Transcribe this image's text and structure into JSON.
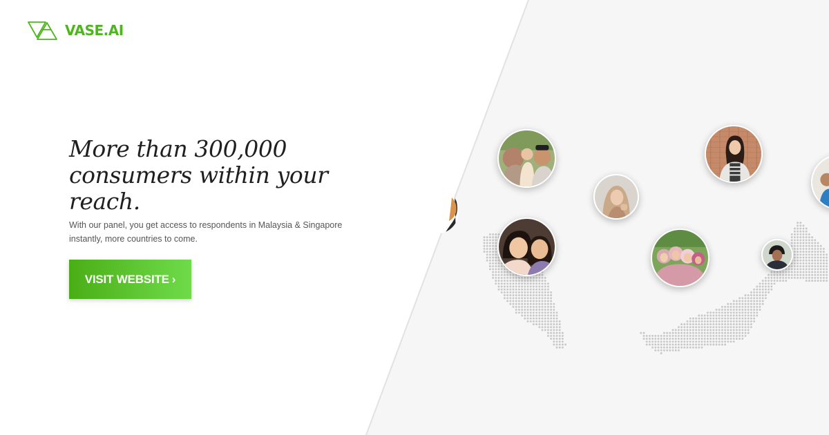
{
  "brand": {
    "name": "VASE.AI",
    "color": "#4fb51f"
  },
  "hero": {
    "headline": "More than 300,000 consumers within your reach.",
    "subtext": "With our panel, you get access to respondents in Malaysia & Singapore instantly, more countries to come.",
    "cta_label": "VISIT WEBSITE",
    "cta_icon": "chevron-right-icon"
  },
  "colors": {
    "accent_start": "#4aae16",
    "accent_end": "#6fdb4a",
    "map_dots": "#c8c8c8"
  }
}
